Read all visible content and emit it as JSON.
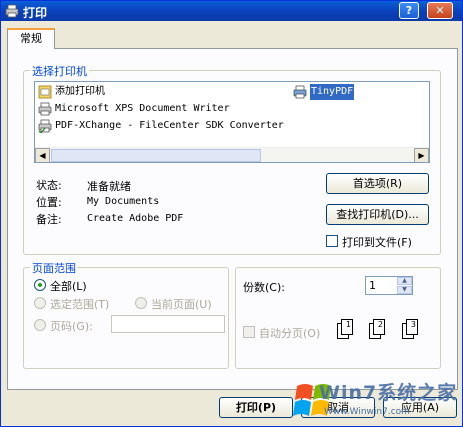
{
  "window": {
    "title": "打印",
    "help": "?",
    "close": "✕"
  },
  "tab": {
    "label": "常规"
  },
  "printer_group": {
    "legend": "选择打印机",
    "printers": [
      {
        "name": "添加打印机",
        "icon": "add-printer-icon"
      },
      {
        "name": "TinyPDF",
        "icon": "printer-icon",
        "selected": true
      },
      {
        "name": "Microsoft XPS Document Writer",
        "icon": "printer-icon"
      },
      {
        "name": "PDF-XChange - FileCenter SDK Converter",
        "icon": "printer-check-icon"
      }
    ],
    "scroll_left": "◀",
    "scroll_right": "▶"
  },
  "info": {
    "status_label": "状态:",
    "status_value": "准备就绪",
    "location_label": "位置:",
    "location_value": "My Documents",
    "comment_label": "备注:",
    "comment_value": "Create Adobe PDF"
  },
  "buttons": {
    "preferences": "首选项(R)",
    "find_printer": "查找打印机(D)...",
    "print_to_file": "打印到文件(F)",
    "print": "打印(P)",
    "cancel": "取消",
    "apply": "应用(A)"
  },
  "page_range": {
    "legend": "页面范围",
    "all": "全部(L)",
    "selection": "选定范围(T)",
    "current": "当前页面(U)",
    "pages": "页码(G):"
  },
  "copies": {
    "label": "份数(C):",
    "value": "1",
    "collate": "自动分页(O)",
    "pages_labels": [
      "1",
      "1",
      "2",
      "2",
      "3",
      "3"
    ]
  },
  "watermark": {
    "text": "Win7系统之家",
    "url": "Www.Winwin7.com"
  },
  "colors": {
    "titlebar": "#0a5fd8",
    "legend": "#0046d5",
    "selection": "#316ac5"
  }
}
